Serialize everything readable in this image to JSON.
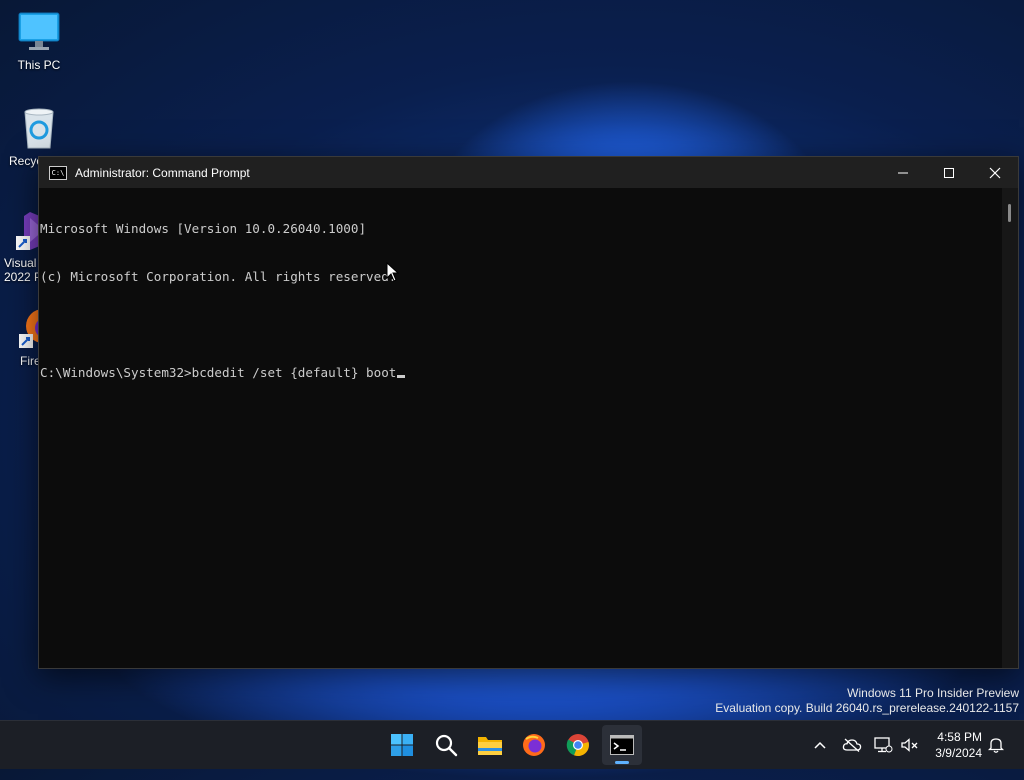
{
  "desktop": {
    "icons": [
      {
        "label": "This PC"
      },
      {
        "label": "Recyc"
      },
      {
        "label": "Visual\n2022 P"
      },
      {
        "label": "Fire"
      }
    ]
  },
  "window": {
    "title": "Administrator: Command Prompt",
    "lines": [
      "Microsoft Windows [Version 10.0.26040.1000]",
      "(c) Microsoft Corporation. All rights reserved.",
      "",
      "C:\\Windows\\System32>bcdedit /set {default} boot"
    ]
  },
  "watermark": {
    "line1": "Windows 11 Pro Insider Preview",
    "line2": "Evaluation copy. Build 26040.rs_prerelease.240122-1157"
  },
  "taskbar": {
    "clock_time": "4:58 PM",
    "clock_date": "3/9/2024"
  },
  "colors": {
    "terminal_bg": "#0c0c0c",
    "terminal_fg": "#cccccc",
    "titlebar_bg": "#202020",
    "taskbar_bg": "#1c1f26",
    "accent": "#5fb2ff"
  }
}
